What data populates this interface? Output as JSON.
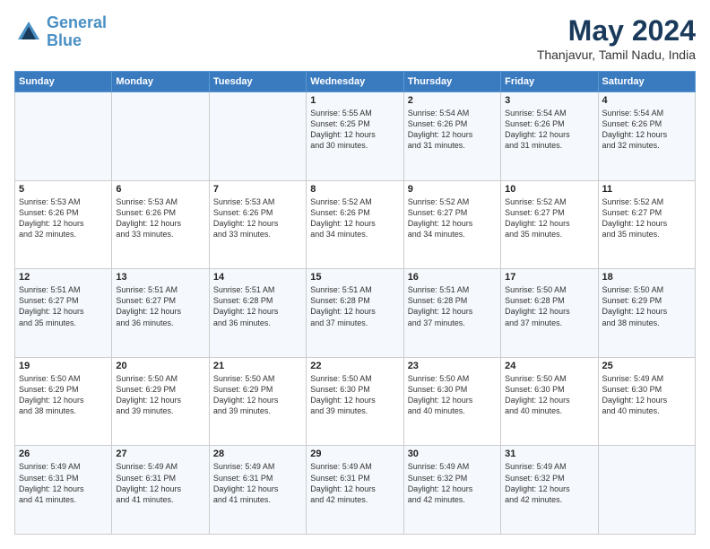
{
  "header": {
    "logo_line1": "General",
    "logo_line2": "Blue",
    "month_year": "May 2024",
    "location": "Thanjavur, Tamil Nadu, India"
  },
  "weekdays": [
    "Sunday",
    "Monday",
    "Tuesday",
    "Wednesday",
    "Thursday",
    "Friday",
    "Saturday"
  ],
  "weeks": [
    [
      {
        "day": "",
        "info": ""
      },
      {
        "day": "",
        "info": ""
      },
      {
        "day": "",
        "info": ""
      },
      {
        "day": "1",
        "info": "Sunrise: 5:55 AM\nSunset: 6:25 PM\nDaylight: 12 hours\nand 30 minutes."
      },
      {
        "day": "2",
        "info": "Sunrise: 5:54 AM\nSunset: 6:26 PM\nDaylight: 12 hours\nand 31 minutes."
      },
      {
        "day": "3",
        "info": "Sunrise: 5:54 AM\nSunset: 6:26 PM\nDaylight: 12 hours\nand 31 minutes."
      },
      {
        "day": "4",
        "info": "Sunrise: 5:54 AM\nSunset: 6:26 PM\nDaylight: 12 hours\nand 32 minutes."
      }
    ],
    [
      {
        "day": "5",
        "info": "Sunrise: 5:53 AM\nSunset: 6:26 PM\nDaylight: 12 hours\nand 32 minutes."
      },
      {
        "day": "6",
        "info": "Sunrise: 5:53 AM\nSunset: 6:26 PM\nDaylight: 12 hours\nand 33 minutes."
      },
      {
        "day": "7",
        "info": "Sunrise: 5:53 AM\nSunset: 6:26 PM\nDaylight: 12 hours\nand 33 minutes."
      },
      {
        "day": "8",
        "info": "Sunrise: 5:52 AM\nSunset: 6:26 PM\nDaylight: 12 hours\nand 34 minutes."
      },
      {
        "day": "9",
        "info": "Sunrise: 5:52 AM\nSunset: 6:27 PM\nDaylight: 12 hours\nand 34 minutes."
      },
      {
        "day": "10",
        "info": "Sunrise: 5:52 AM\nSunset: 6:27 PM\nDaylight: 12 hours\nand 35 minutes."
      },
      {
        "day": "11",
        "info": "Sunrise: 5:52 AM\nSunset: 6:27 PM\nDaylight: 12 hours\nand 35 minutes."
      }
    ],
    [
      {
        "day": "12",
        "info": "Sunrise: 5:51 AM\nSunset: 6:27 PM\nDaylight: 12 hours\nand 35 minutes."
      },
      {
        "day": "13",
        "info": "Sunrise: 5:51 AM\nSunset: 6:27 PM\nDaylight: 12 hours\nand 36 minutes."
      },
      {
        "day": "14",
        "info": "Sunrise: 5:51 AM\nSunset: 6:28 PM\nDaylight: 12 hours\nand 36 minutes."
      },
      {
        "day": "15",
        "info": "Sunrise: 5:51 AM\nSunset: 6:28 PM\nDaylight: 12 hours\nand 37 minutes."
      },
      {
        "day": "16",
        "info": "Sunrise: 5:51 AM\nSunset: 6:28 PM\nDaylight: 12 hours\nand 37 minutes."
      },
      {
        "day": "17",
        "info": "Sunrise: 5:50 AM\nSunset: 6:28 PM\nDaylight: 12 hours\nand 37 minutes."
      },
      {
        "day": "18",
        "info": "Sunrise: 5:50 AM\nSunset: 6:29 PM\nDaylight: 12 hours\nand 38 minutes."
      }
    ],
    [
      {
        "day": "19",
        "info": "Sunrise: 5:50 AM\nSunset: 6:29 PM\nDaylight: 12 hours\nand 38 minutes."
      },
      {
        "day": "20",
        "info": "Sunrise: 5:50 AM\nSunset: 6:29 PM\nDaylight: 12 hours\nand 39 minutes."
      },
      {
        "day": "21",
        "info": "Sunrise: 5:50 AM\nSunset: 6:29 PM\nDaylight: 12 hours\nand 39 minutes."
      },
      {
        "day": "22",
        "info": "Sunrise: 5:50 AM\nSunset: 6:30 PM\nDaylight: 12 hours\nand 39 minutes."
      },
      {
        "day": "23",
        "info": "Sunrise: 5:50 AM\nSunset: 6:30 PM\nDaylight: 12 hours\nand 40 minutes."
      },
      {
        "day": "24",
        "info": "Sunrise: 5:50 AM\nSunset: 6:30 PM\nDaylight: 12 hours\nand 40 minutes."
      },
      {
        "day": "25",
        "info": "Sunrise: 5:49 AM\nSunset: 6:30 PM\nDaylight: 12 hours\nand 40 minutes."
      }
    ],
    [
      {
        "day": "26",
        "info": "Sunrise: 5:49 AM\nSunset: 6:31 PM\nDaylight: 12 hours\nand 41 minutes."
      },
      {
        "day": "27",
        "info": "Sunrise: 5:49 AM\nSunset: 6:31 PM\nDaylight: 12 hours\nand 41 minutes."
      },
      {
        "day": "28",
        "info": "Sunrise: 5:49 AM\nSunset: 6:31 PM\nDaylight: 12 hours\nand 41 minutes."
      },
      {
        "day": "29",
        "info": "Sunrise: 5:49 AM\nSunset: 6:31 PM\nDaylight: 12 hours\nand 42 minutes."
      },
      {
        "day": "30",
        "info": "Sunrise: 5:49 AM\nSunset: 6:32 PM\nDaylight: 12 hours\nand 42 minutes."
      },
      {
        "day": "31",
        "info": "Sunrise: 5:49 AM\nSunset: 6:32 PM\nDaylight: 12 hours\nand 42 minutes."
      },
      {
        "day": "",
        "info": ""
      }
    ]
  ]
}
